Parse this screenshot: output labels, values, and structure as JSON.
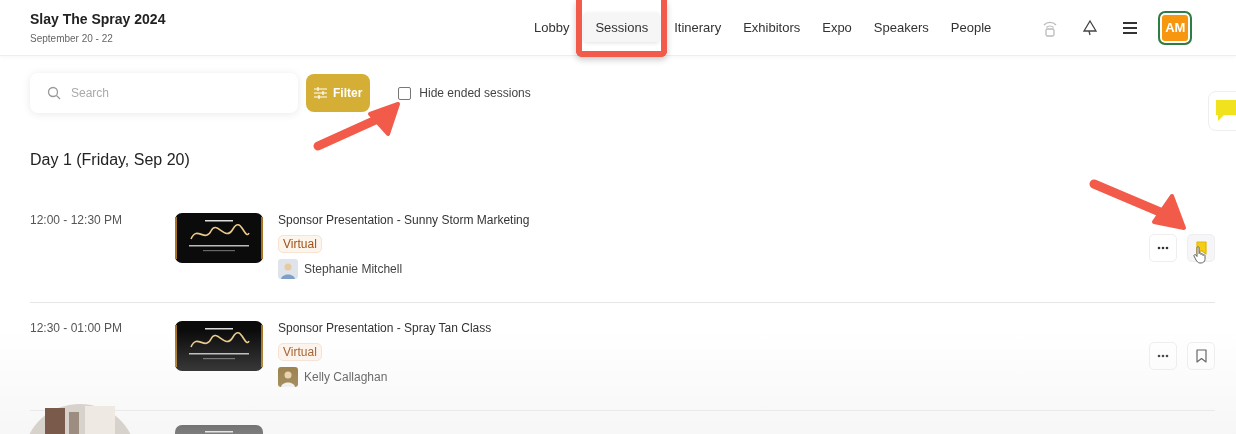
{
  "event": {
    "title": "Slay The Spray 2024",
    "dates": "September 20 - 22"
  },
  "nav": [
    {
      "label": "Lobby",
      "selected": false
    },
    {
      "label": "Sessions",
      "selected": true
    },
    {
      "label": "Itinerary",
      "selected": false
    },
    {
      "label": "Exhibitors",
      "selected": false
    },
    {
      "label": "Expo",
      "selected": false
    },
    {
      "label": "Speakers",
      "selected": false
    },
    {
      "label": "People",
      "selected": false
    }
  ],
  "avatar": {
    "initials": "AM"
  },
  "search": {
    "placeholder": "Search"
  },
  "filter": {
    "label": "Filter"
  },
  "hide_ended": {
    "label": "Hide ended sessions",
    "checked": false
  },
  "day_heading": "Day 1  (Friday, Sep 20)",
  "sessions": [
    {
      "time": "12:00 - 12:30 PM",
      "title": "Sponsor Presentation - Sunny Storm Marketing",
      "tag": "Virtual",
      "speaker": "Stephanie Mitchell",
      "saved": true
    },
    {
      "time": "12:30 - 01:00 PM",
      "title": "Sponsor Presentation - Spray Tan Class",
      "tag": "Virtual",
      "speaker": "Kelly Callaghan",
      "saved": false
    }
  ]
}
